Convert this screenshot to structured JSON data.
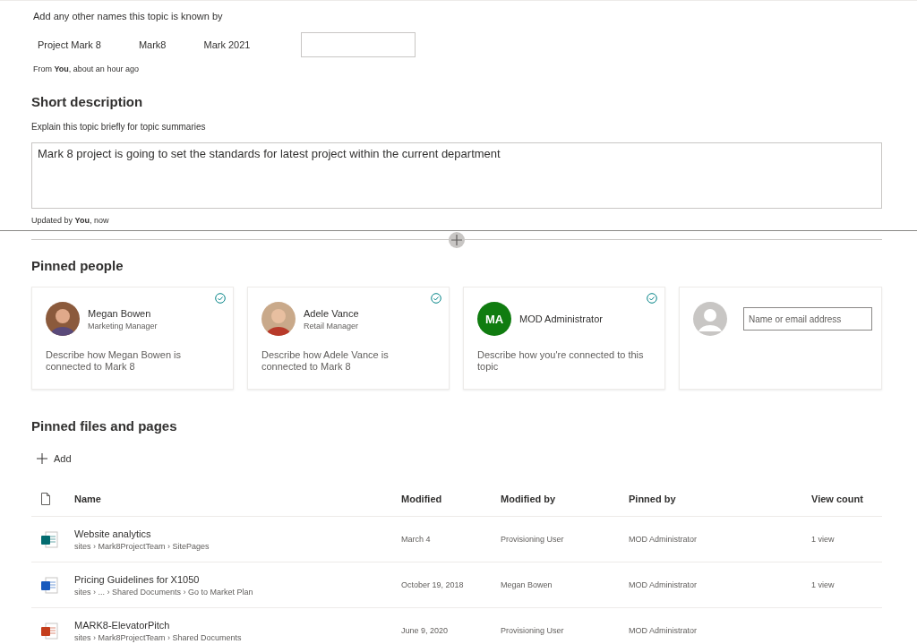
{
  "aliases": {
    "label": "Add any other names this topic is known by",
    "names": [
      "Project Mark 8",
      "Mark8",
      "Mark 2021"
    ],
    "footer": "From **You**, about an hour ago"
  },
  "short_description": {
    "heading": "Short description",
    "hint": "Explain this topic briefly for topic summaries",
    "value": "Mark 8 project is going to set the standards for latest project within the current department",
    "footer": "Updated by **You**, now"
  },
  "pinned_people": {
    "heading": "Pinned people",
    "people": [
      {
        "kind": "photo",
        "name": "Megan Bowen",
        "role": "Marketing Manager",
        "description": "Describe how Megan Bowen is connected to Mark 8"
      },
      {
        "kind": "photo",
        "name": "Adele Vance",
        "role": "Retail Manager",
        "description": "Describe how Adele Vance is connected to Mark 8"
      },
      {
        "kind": "initials",
        "initials": "MA",
        "color": "#107c10",
        "name": "MOD Administrator",
        "description": "Describe how you're connected to this topic"
      },
      {
        "kind": "add",
        "placeholder": "Name or email address"
      }
    ]
  },
  "pinned_files": {
    "heading": "Pinned files and pages",
    "add": "Add",
    "columns": [
      "Name",
      "Modified",
      "Modified by",
      "Pinned by",
      "View count"
    ],
    "rows": [
      {
        "kind": "sharepoint",
        "name": "Website analytics",
        "path": "sites › Mark8ProjectTeam › SitePages",
        "modified": "March 4",
        "modified_by": "Provisioning User",
        "pinned_by": "MOD Administrator",
        "views": "1 view"
      },
      {
        "kind": "word",
        "name": "Pricing Guidelines for X1050",
        "path": "sites › ... › Shared Documents › Go to Market Plan",
        "modified": "October 19, 2018",
        "modified_by": "Megan Bowen",
        "pinned_by": "MOD Administrator",
        "views": "1 view"
      },
      {
        "kind": "powerpoint",
        "name": "MARK8-ElevatorPitch",
        "path": "sites › Mark8ProjectTeam › Shared Documents",
        "modified": "June 9, 2020",
        "modified_by": "Provisioning User",
        "pinned_by": "MOD Administrator"
      }
    ]
  }
}
